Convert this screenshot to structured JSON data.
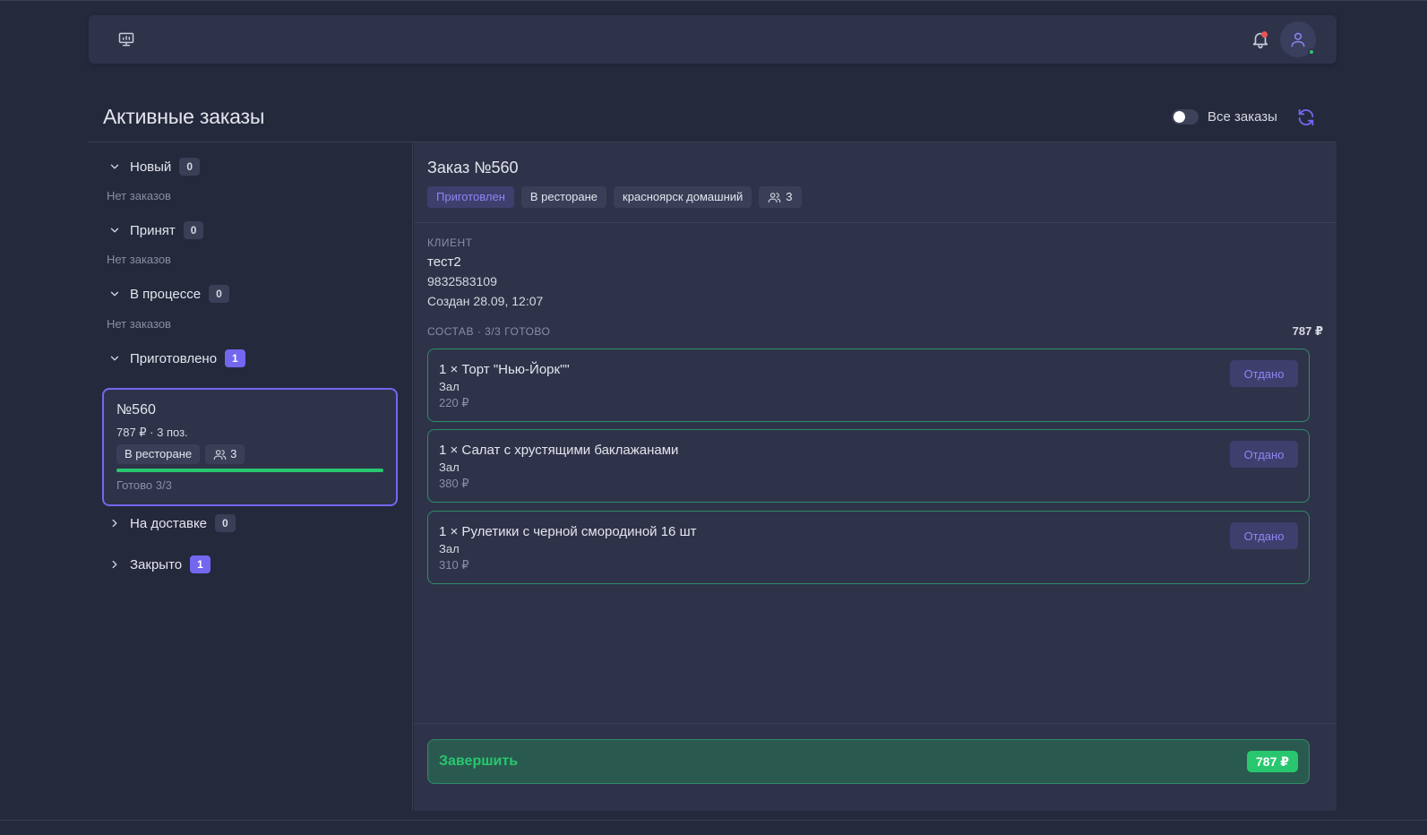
{
  "header": {
    "icons": {
      "app": "monitor-icon",
      "notifications": "bell-icon",
      "profile": "user-icon"
    }
  },
  "page": {
    "title": "Активные заказы",
    "all_orders_toggle_label": "Все заказы"
  },
  "groups": [
    {
      "label": "Новый",
      "count": "0",
      "empty": "Нет заказов",
      "expanded": true
    },
    {
      "label": "Принят",
      "count": "0",
      "empty": "Нет заказов",
      "expanded": true
    },
    {
      "label": "В процессе",
      "count": "0",
      "empty": "Нет заказов",
      "expanded": true
    },
    {
      "label": "Приготовлено",
      "count": "1",
      "expanded": true
    },
    {
      "label": "На доставке",
      "count": "0",
      "expanded": false
    },
    {
      "label": "Закрыто",
      "count": "1",
      "expanded": false
    }
  ],
  "order_card": {
    "number": "№560",
    "meta": "787 ₽ · 3 поз.",
    "type": "В ресторане",
    "guests": "3",
    "progress": 1.0,
    "ready": "Готово 3/3"
  },
  "order": {
    "title": "Заказ №560",
    "tags": {
      "status": "Приготовлен",
      "type": "В ресторане",
      "location": "красноярск домашний",
      "guests": "3"
    },
    "client_label": "КЛИЕНТ",
    "client_name": "тест2",
    "client_phone": "9832583109",
    "created": "Создан 28.09, 12:07",
    "composition_label": "СОСТАВ · 3/3 ГОТОВО",
    "composition_total": "787 ₽",
    "items": [
      {
        "title": "1 × Торт \"Нью-Йорк\"\"",
        "place": "Зал",
        "price": "220 ₽",
        "button": "Отдано"
      },
      {
        "title": "1 × Салат с хрустящими баклажанами",
        "place": "Зал",
        "price": "380 ₽",
        "button": "Отдано"
      },
      {
        "title": "1 × Рулетики с черной смородиной 16 шт",
        "place": "Зал",
        "price": "310 ₽",
        "button": "Отдано"
      }
    ],
    "finish_label": "Завершить",
    "finish_total": "787 ₽"
  },
  "colors": {
    "accent": "#7367f0",
    "success": "#28c76f",
    "background": "#25293c",
    "panel": "#2f3349"
  }
}
